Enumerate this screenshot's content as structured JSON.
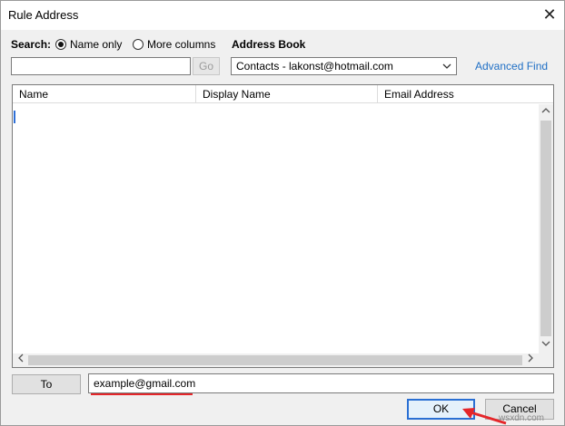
{
  "window": {
    "title": "Rule Address",
    "close_glyph": "✕"
  },
  "search": {
    "label": "Search:",
    "options": [
      {
        "label": "Name only",
        "selected": true
      },
      {
        "label": "More columns",
        "selected": false
      }
    ],
    "input_value": "",
    "go_label": "Go"
  },
  "address_book": {
    "label": "Address Book",
    "selected": "Contacts - lakonst@hotmail.com",
    "dropdown_icon": "chevron-down-icon",
    "advanced_find": "Advanced Find"
  },
  "list": {
    "columns": [
      "Name",
      "Display Name",
      "Email Address"
    ],
    "rows": []
  },
  "recipient": {
    "to_label": "To",
    "value": "example@gmail.com"
  },
  "footer": {
    "ok_label": "OK",
    "cancel_label": "Cancel"
  },
  "watermark": "wsxdn.com",
  "colors": {
    "accent_blue": "#2a6fd3",
    "link_blue": "#1f6fc5",
    "annotation_red": "#e5262a"
  }
}
